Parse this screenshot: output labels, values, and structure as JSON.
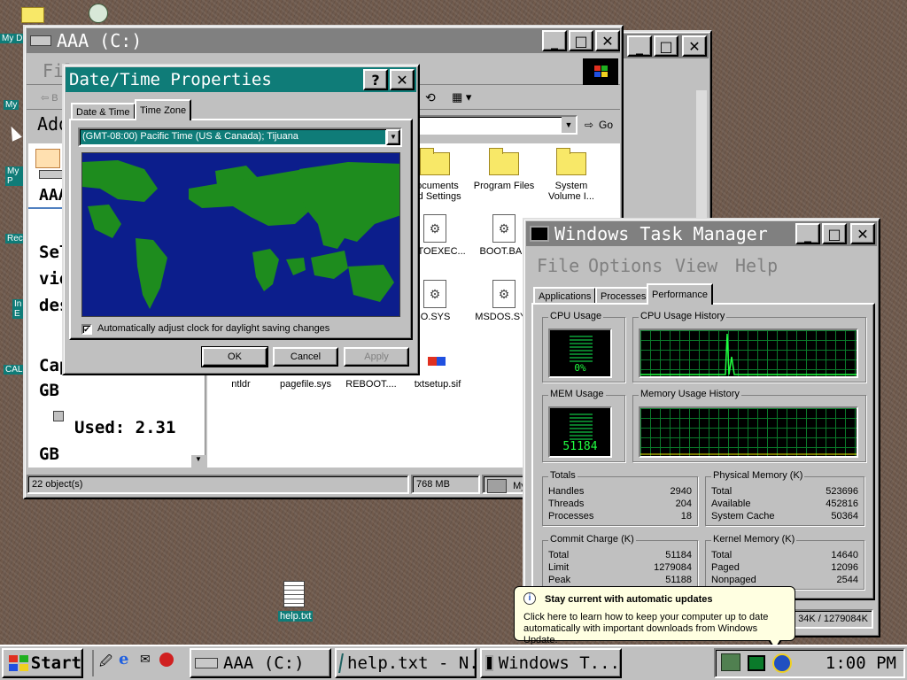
{
  "desktop": {
    "icon_labels": [
      "My D",
      "My",
      "My P",
      "Rec",
      "In E",
      "CAL"
    ],
    "help_icon_label": "help.txt"
  },
  "explorer_back": {
    "min": "_",
    "max": "□",
    "close": "✕"
  },
  "explorer": {
    "title": "AAA (C:)",
    "menu_partial": "Fil",
    "back_partial": "⇦ B",
    "address_label_partial": "Add",
    "go_label": "Go",
    "side_big_title": "AAA",
    "side_text": [
      "Sel",
      "vie",
      "des"
    ],
    "capacity_lines": [
      "Cap",
      "GB"
    ],
    "used_label": "Used: 2.31",
    "used_gb": "GB",
    "files_row1": [
      {
        "icon": "folder",
        "label": "Documents\nand Settings"
      },
      {
        "icon": "folder",
        "label": "Program Files"
      },
      {
        "icon": "folder",
        "label": "System\nVolume I..."
      }
    ],
    "files_row2": [
      {
        "icon": "file",
        "label": "AUTOEXEC..."
      },
      {
        "icon": "file",
        "label": "BOOT.BAK"
      }
    ],
    "files_row3": [
      {
        "icon": "file",
        "label": "IO.SYS"
      },
      {
        "icon": "file",
        "label": "MSDOS.SYS"
      }
    ],
    "files_row4": [
      {
        "label": "ntldr"
      },
      {
        "label": "pagefile.sys"
      },
      {
        "label": "REBOOT...."
      },
      {
        "label": "txtsetup.sif"
      }
    ],
    "status_objects": "22 object(s)",
    "status_size": "768 MB",
    "status_computer": "My"
  },
  "datetime": {
    "title": "Date/Time Properties",
    "help_btn": "?",
    "close_btn": "✕",
    "tabs": [
      "Date & Time",
      "Time Zone"
    ],
    "timezone_selected": "(GMT-08:00) Pacific Time (US & Canada); Tijuana",
    "dst_checkbox_label": "Automatically adjust clock for daylight saving changes",
    "dst_checked": "✔",
    "buttons": {
      "ok": "OK",
      "cancel": "Cancel",
      "apply": "Apply"
    },
    "colors": {
      "ocean": "#0c1e8c",
      "land": "#1e8c1e"
    }
  },
  "taskmgr": {
    "title": "Windows Task Manager",
    "menu": [
      "File",
      "Options",
      "View",
      "Help"
    ],
    "tabs": [
      "Applications",
      "Processes",
      "Performance"
    ],
    "cpu_usage_label": "CPU Usage",
    "cpu_usage_value": "0%",
    "cpu_history_label": "CPU Usage History",
    "mem_usage_label": "MEM Usage",
    "mem_usage_value": "51184",
    "mem_history_label": "Memory Usage History",
    "totals": {
      "label": "Totals",
      "rows": [
        {
          "k": "Handles",
          "v": "2940"
        },
        {
          "k": "Threads",
          "v": "204"
        },
        {
          "k": "Processes",
          "v": "18"
        }
      ]
    },
    "physical": {
      "label": "Physical Memory (K)",
      "rows": [
        {
          "k": "Total",
          "v": "523696"
        },
        {
          "k": "Available",
          "v": "452816"
        },
        {
          "k": "System Cache",
          "v": "50364"
        }
      ]
    },
    "commit": {
      "label": "Commit Charge (K)",
      "rows": [
        {
          "k": "Total",
          "v": "51184"
        },
        {
          "k": "Limit",
          "v": "1279084"
        },
        {
          "k": "Peak",
          "v": "51188"
        }
      ]
    },
    "kernel": {
      "label": "Kernel Memory (K)",
      "rows": [
        {
          "k": "Total",
          "v": "14640"
        },
        {
          "k": "Paged",
          "v": "12096"
        },
        {
          "k": "Nonpaged",
          "v": "2544"
        }
      ]
    },
    "status_commit": "34K / 1279084K"
  },
  "balloon": {
    "title": "Stay current with automatic updates",
    "body": "Click here to learn how to keep your computer up to date automatically with important downloads from Windows Update."
  },
  "taskbar": {
    "start_label": "Start",
    "buttons": [
      "AAA (C:)",
      "help.txt - N...",
      "Windows T..."
    ],
    "clock": "1:00 PM"
  }
}
